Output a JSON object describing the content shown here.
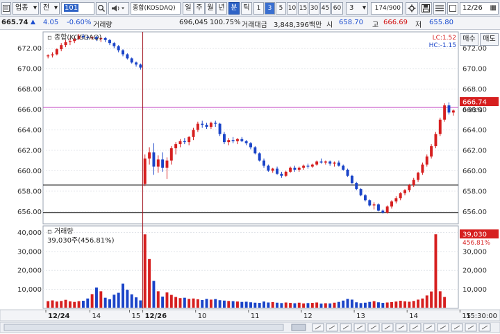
{
  "toolbar": {
    "market_type": "업종",
    "market_mode": "전",
    "index_code": "101",
    "index_name": "종합(KOSDAQ)",
    "periods": [
      "일",
      "주",
      "월",
      "년",
      "분",
      "틱"
    ],
    "active_period": "분",
    "intervals": [
      "1",
      "3",
      "5",
      "10",
      "15",
      "30",
      "45",
      "60"
    ],
    "active_interval": "3",
    "interval_value": "3",
    "count": "174/900",
    "date": "12/26",
    "icons": [
      "search-icon",
      "speaker-icon",
      "settings-icon",
      "save-icon",
      "list-icon",
      "checkbox-icon"
    ]
  },
  "quote": {
    "price": "665.74",
    "change_arrow": "▲",
    "change": "4.05",
    "change_pct": "-0.60%",
    "volume_label": "거래량",
    "volume": "696,045",
    "volume_pct": "100.75%",
    "amount_label": "거래대금",
    "amount": "3,848,396백만",
    "open_label": "시",
    "open": "658.70",
    "high_label": "고",
    "high": "666.69",
    "low_label": "저",
    "low": "655.80"
  },
  "side_buttons": {
    "buy": "매수",
    "sell": "매도"
  },
  "chart_data": {
    "type": "candlestick",
    "price_panel": {
      "title": "종합(KOSDAQ)",
      "lc_label": "LC:1.52",
      "hc_label": "HC:-1.15",
      "y_ticks": [
        "672.00",
        "670.00",
        "668.00",
        "666.00",
        "664.00",
        "662.00",
        "660.00",
        "658.00",
        "656.00"
      ],
      "ylim": [
        654.8,
        673.6
      ],
      "last_price": "666.74",
      "last_price_pct": "0.03%",
      "horizontal_lines": [
        666.2,
        658.6,
        655.9
      ],
      "session_divider_index": 22,
      "candles": [
        [
          671.2,
          671.4,
          671.0,
          671.3
        ],
        [
          671.3,
          671.6,
          671.1,
          671.4
        ],
        [
          671.4,
          672.0,
          671.3,
          671.9
        ],
        [
          671.9,
          672.5,
          671.7,
          672.3
        ],
        [
          672.3,
          672.8,
          672.1,
          672.6
        ],
        [
          672.6,
          673.0,
          672.3,
          672.7
        ],
        [
          672.7,
          673.1,
          672.5,
          672.9
        ],
        [
          672.9,
          673.4,
          672.8,
          673.2
        ],
        [
          673.2,
          673.4,
          672.9,
          673.1
        ],
        [
          673.1,
          673.3,
          672.8,
          673.0
        ],
        [
          673.0,
          673.2,
          672.8,
          673.1
        ],
        [
          673.1,
          673.2,
          672.7,
          672.9
        ],
        [
          672.9,
          673.1,
          672.6,
          673.0
        ],
        [
          673.0,
          673.1,
          672.6,
          672.8
        ],
        [
          672.8,
          672.9,
          672.3,
          672.5
        ],
        [
          672.5,
          672.6,
          672.0,
          672.2
        ],
        [
          672.2,
          672.3,
          671.6,
          671.8
        ],
        [
          671.8,
          671.9,
          671.2,
          671.4
        ],
        [
          671.4,
          671.5,
          670.9,
          671.0
        ],
        [
          671.0,
          671.1,
          670.5,
          670.6
        ],
        [
          670.6,
          670.7,
          670.2,
          670.4
        ],
        [
          670.4,
          670.5,
          669.9,
          670.1
        ],
        [
          658.7,
          661.6,
          658.5,
          661.2
        ],
        [
          661.2,
          662.3,
          660.6,
          661.8
        ],
        [
          661.8,
          662.7,
          659.6,
          660.4
        ],
        [
          660.4,
          661.5,
          659.8,
          661.1
        ],
        [
          661.1,
          661.8,
          659.9,
          660.3
        ],
        [
          660.3,
          661.3,
          659.2,
          661.0
        ],
        [
          661.0,
          662.4,
          660.6,
          662.2
        ],
        [
          662.2,
          662.8,
          661.6,
          662.6
        ],
        [
          662.6,
          663.1,
          662.3,
          662.9
        ],
        [
          662.9,
          663.2,
          662.6,
          662.8
        ],
        [
          662.8,
          663.4,
          662.5,
          663.3
        ],
        [
          663.3,
          664.2,
          663.0,
          664.0
        ],
        [
          664.0,
          664.8,
          663.8,
          664.6
        ],
        [
          664.6,
          664.9,
          664.2,
          664.5
        ],
        [
          664.5,
          664.7,
          664.1,
          664.3
        ],
        [
          664.3,
          664.8,
          664.1,
          664.7
        ],
        [
          664.7,
          664.9,
          664.3,
          664.6
        ],
        [
          664.6,
          664.7,
          663.4,
          663.6
        ],
        [
          663.6,
          663.8,
          662.6,
          662.8
        ],
        [
          662.8,
          663.2,
          662.5,
          663.0
        ],
        [
          663.0,
          663.3,
          662.7,
          662.9
        ],
        [
          662.9,
          663.2,
          662.6,
          663.1
        ],
        [
          663.1,
          663.3,
          662.8,
          662.9
        ],
        [
          662.9,
          663.0,
          662.5,
          662.7
        ],
        [
          662.7,
          662.8,
          662.1,
          662.3
        ],
        [
          662.3,
          662.4,
          661.6,
          661.7
        ],
        [
          661.7,
          661.8,
          660.9,
          661.0
        ],
        [
          661.0,
          661.2,
          660.3,
          660.5
        ],
        [
          660.5,
          660.6,
          659.9,
          660.0
        ],
        [
          660.0,
          660.3,
          659.8,
          660.2
        ],
        [
          660.2,
          660.4,
          659.6,
          659.7
        ],
        [
          659.7,
          659.9,
          659.3,
          659.5
        ],
        [
          659.5,
          660.0,
          659.4,
          659.9
        ],
        [
          659.9,
          660.4,
          659.8,
          660.3
        ],
        [
          660.3,
          660.5,
          659.9,
          660.1
        ],
        [
          660.1,
          660.4,
          659.9,
          660.3
        ],
        [
          660.3,
          660.6,
          660.1,
          660.5
        ],
        [
          660.5,
          660.7,
          660.2,
          660.4
        ],
        [
          660.4,
          660.7,
          660.3,
          660.6
        ],
        [
          660.6,
          661.0,
          660.5,
          660.9
        ],
        [
          660.9,
          661.2,
          660.7,
          660.8
        ],
        [
          660.8,
          661.0,
          660.6,
          660.9
        ],
        [
          660.9,
          661.0,
          660.5,
          660.7
        ],
        [
          660.7,
          660.9,
          660.4,
          660.8
        ],
        [
          660.8,
          661.0,
          660.4,
          660.5
        ],
        [
          660.5,
          660.6,
          660.0,
          660.1
        ],
        [
          660.1,
          660.2,
          659.4,
          659.5
        ],
        [
          659.5,
          659.6,
          658.7,
          658.8
        ],
        [
          658.8,
          658.9,
          658.1,
          658.2
        ],
        [
          658.2,
          658.3,
          657.5,
          657.6
        ],
        [
          657.6,
          657.7,
          657.0,
          657.1
        ],
        [
          657.1,
          657.2,
          656.5,
          656.6
        ],
        [
          656.6,
          656.9,
          656.2,
          656.7
        ],
        [
          656.7,
          656.8,
          656.0,
          656.1
        ],
        [
          656.1,
          656.2,
          655.8,
          655.9
        ],
        [
          655.9,
          656.6,
          655.8,
          656.5
        ],
        [
          656.5,
          657.1,
          656.3,
          657.0
        ],
        [
          657.0,
          657.5,
          656.8,
          657.3
        ],
        [
          657.3,
          657.9,
          657.1,
          657.8
        ],
        [
          657.8,
          658.2,
          657.6,
          658.1
        ],
        [
          658.1,
          658.7,
          657.9,
          658.6
        ],
        [
          658.6,
          659.3,
          658.4,
          659.1
        ],
        [
          659.1,
          659.9,
          658.9,
          659.8
        ],
        [
          659.8,
          660.8,
          659.6,
          660.6
        ],
        [
          660.6,
          661.6,
          660.4,
          661.4
        ],
        [
          661.4,
          662.6,
          661.2,
          662.4
        ],
        [
          662.4,
          663.8,
          662.2,
          663.6
        ],
        [
          663.6,
          665.2,
          663.4,
          665.0
        ],
        [
          665.0,
          666.6,
          664.8,
          666.4
        ],
        [
          666.4,
          666.7,
          665.5,
          665.7
        ],
        [
          665.7,
          666.0,
          665.4,
          665.9
        ]
      ]
    },
    "volume_panel": {
      "title": "거래량",
      "current_label": "39,030주(456.81%)",
      "y_ticks": [
        "40,000",
        "30,000",
        "20,000",
        "10,000"
      ],
      "ylim": [
        0,
        42000
      ],
      "last_volume": "39,030",
      "last_volume_pct": "456.81%",
      "values": [
        3800,
        4200,
        3600,
        3900,
        4500,
        3700,
        3400,
        3800,
        4000,
        5200,
        7500,
        11000,
        9000,
        5600,
        4800,
        7200,
        8200,
        13000,
        9800,
        7400,
        5800,
        4200,
        39000,
        26000,
        14500,
        9000,
        6200,
        8400,
        7100,
        6000,
        5400,
        5600,
        5000,
        5200,
        4800,
        4400,
        5000,
        4600,
        4900,
        4300,
        4100,
        3900,
        3800,
        3600,
        3400,
        3500,
        3200,
        3000,
        2900,
        3600,
        3100,
        3300,
        3000,
        2800,
        3100,
        2900,
        2700,
        3000,
        2600,
        2800,
        2900,
        3100,
        2500,
        2700,
        2600,
        3000,
        3400,
        4100,
        5000,
        4600,
        3200,
        2800,
        3000,
        3400,
        3800,
        3200,
        2900,
        3100,
        3300,
        3600,
        4000,
        3700,
        3500,
        3900,
        4600,
        5200,
        6800,
        8900,
        39030,
        9000,
        6000
      ]
    },
    "x_labels": [
      {
        "index": 0,
        "label": "12/24",
        "bold": true
      },
      {
        "index": 10,
        "label": "14",
        "bold": false
      },
      {
        "index": 19,
        "label": "15",
        "bold": false
      },
      {
        "index": 22,
        "label": "12/26",
        "bold": true
      },
      {
        "index": 34,
        "label": "10",
        "bold": false
      },
      {
        "index": 46,
        "label": "11",
        "bold": false
      },
      {
        "index": 58,
        "label": "12",
        "bold": false
      },
      {
        "index": 70,
        "label": "13",
        "bold": false
      },
      {
        "index": 82,
        "label": "14",
        "bold": false
      },
      {
        "index": 94,
        "label": "15",
        "bold": false
      }
    ],
    "time_label": "15:30:00"
  },
  "colors": {
    "up": "#d61f1f",
    "down": "#1a44c8",
    "divider": "#a0101b",
    "ref_line": "#c040c0",
    "current_tag": "#d61f1f"
  }
}
